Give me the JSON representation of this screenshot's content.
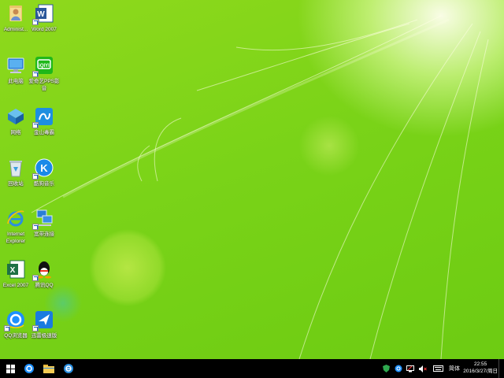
{
  "desktop": {
    "icons": [
      {
        "label": "Administ...",
        "icon": "user-folder-icon"
      },
      {
        "label": "Word 2007",
        "icon": "word-icon"
      },
      {
        "label": "此电脑",
        "icon": "computer-icon"
      },
      {
        "label": "爱奇艺PPS影音",
        "icon": "iqiyi-icon"
      },
      {
        "label": "网络",
        "icon": "network-icon"
      },
      {
        "label": "金山毒霸",
        "icon": "kingsoft-antivirus-icon"
      },
      {
        "label": "回收站",
        "icon": "recycle-bin-icon"
      },
      {
        "label": "酷狗音乐",
        "icon": "kugou-music-icon"
      },
      {
        "label": "Internet Explorer",
        "icon": "internet-explorer-icon"
      },
      {
        "label": "宽带连接",
        "icon": "broadband-connection-icon"
      },
      {
        "label": "Excel 2007",
        "icon": "excel-icon"
      },
      {
        "label": "腾讯QQ",
        "icon": "qq-icon"
      },
      {
        "label": "QQ浏览器",
        "icon": "qq-browser-icon"
      },
      {
        "label": "迅雷极速版",
        "icon": "xunlei-icon"
      }
    ]
  },
  "taskbar": {
    "start": "windows-start-icon",
    "pinned": [
      "qq-browser-icon",
      "file-explorer-icon",
      "internet-explorer-icon"
    ],
    "tray_icons": [
      "shield-icon",
      "qq-browser-tray-icon",
      "network-icon",
      "volume-icon",
      "keyboard-icon"
    ],
    "ime_label": "简体",
    "time": "22:55",
    "date": "2016/3/27/周日"
  },
  "colors": {
    "wallpaper": "#7ad318",
    "taskbar": "#000000"
  }
}
